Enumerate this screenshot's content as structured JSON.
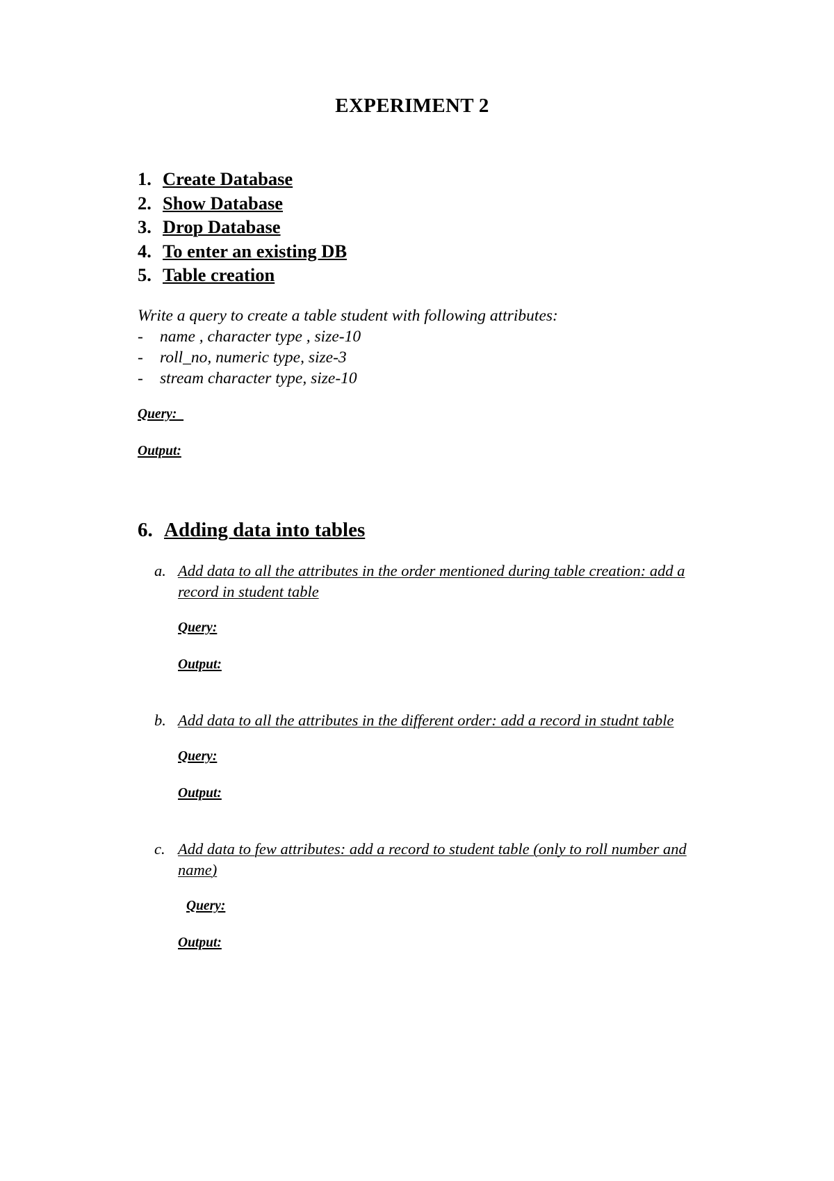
{
  "document": {
    "title": "EXPERIMENT 2",
    "main_list": [
      {
        "num": "1.",
        "text": "Create Database"
      },
      {
        "num": "2.",
        "text": "Show Database"
      },
      {
        "num": "3.",
        "text": "Drop Database"
      },
      {
        "num": "4.",
        "text": "To enter an existing DB"
      },
      {
        "num": "5.",
        "text": "Table creation"
      }
    ],
    "intro_paragraph": "Write a query to create a table student with following attributes:",
    "attributes": [
      {
        "dash": "-",
        "text": "name , character type , size-10"
      },
      {
        "dash": "-",
        "text": "roll_no, numeric type, size-3"
      },
      {
        "dash": "-",
        "text": "stream character type, size-10"
      }
    ],
    "table_creation_labels": {
      "query": "Query:  ",
      "output": "Output:"
    },
    "section6": {
      "num": "6.",
      "title": "Adding data into tables",
      "items": [
        {
          "letter": "a.",
          "text": "Add data to all the attributes in the order mentioned during table creation: add a record in student table",
          "query_label": "Query:",
          "output_label": "Output:"
        },
        {
          "letter": "b.",
          "text": "Add data to all the attributes in the different order: add a record in studnt table",
          "query_label": "Query:",
          "output_label": "Output:"
        },
        {
          "letter": "c.",
          "text": "Add data to few attributes: add a record to student table (only to roll number and name)",
          "query_label": "Query:",
          "output_label": "Output:"
        }
      ]
    }
  }
}
